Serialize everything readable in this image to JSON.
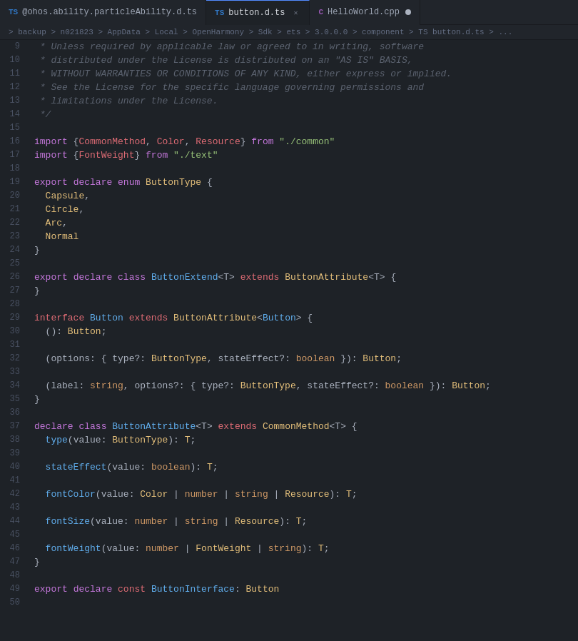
{
  "tabs": [
    {
      "id": "tab1",
      "icon": "ts",
      "label": "@ohos.ability.particleAbility.d.ts",
      "active": false,
      "modified": false
    },
    {
      "id": "tab2",
      "icon": "ts",
      "label": "button.d.ts",
      "active": true,
      "modified": false
    },
    {
      "id": "tab3",
      "icon": "cpp",
      "label": "HelloWorld.cpp",
      "active": false,
      "modified": true
    }
  ],
  "breadcrumb": "> backup > n021823 > AppData > Local > OpenHarmony > Sdk > ets > 3.0.0.0 > component > TS button.d.ts > ...",
  "lines": [
    {
      "num": 9,
      "tokens": [
        {
          "t": " * Unless required by applicable law or agreed to in writing, software",
          "c": "comment"
        }
      ]
    },
    {
      "num": 10,
      "tokens": [
        {
          "t": " * distributed under the License is distributed on an \"AS IS\" BASIS,",
          "c": "comment"
        }
      ]
    },
    {
      "num": 11,
      "tokens": [
        {
          "t": " * WITHOUT WARRANTIES OR CONDITIONS OF ANY KIND, either express or implied.",
          "c": "comment"
        }
      ]
    },
    {
      "num": 12,
      "tokens": [
        {
          "t": " * See the License for the specific language governing permissions and",
          "c": "comment"
        }
      ]
    },
    {
      "num": 13,
      "tokens": [
        {
          "t": " * limitations under the License.",
          "c": "comment"
        }
      ]
    },
    {
      "num": 14,
      "tokens": [
        {
          "t": " */",
          "c": "comment"
        }
      ]
    },
    {
      "num": 15,
      "tokens": []
    },
    {
      "num": 16,
      "tokens": [
        {
          "t": "import",
          "c": "kw"
        },
        {
          "t": " {",
          "c": "punct"
        },
        {
          "t": "CommonMethod",
          "c": "import-name"
        },
        {
          "t": ", ",
          "c": "punct"
        },
        {
          "t": "Color",
          "c": "import-name"
        },
        {
          "t": ", ",
          "c": "punct"
        },
        {
          "t": "Resource",
          "c": "import-name"
        },
        {
          "t": "} ",
          "c": "punct"
        },
        {
          "t": "from",
          "c": "from-kw"
        },
        {
          "t": " ",
          "c": ""
        },
        {
          "t": "\"./common\"",
          "c": "str"
        }
      ]
    },
    {
      "num": 17,
      "tokens": [
        {
          "t": "import",
          "c": "kw"
        },
        {
          "t": " {",
          "c": "punct"
        },
        {
          "t": "FontWeight",
          "c": "import-name"
        },
        {
          "t": "} ",
          "c": "punct"
        },
        {
          "t": "from",
          "c": "from-kw"
        },
        {
          "t": " ",
          "c": ""
        },
        {
          "t": "\"./text\"",
          "c": "str"
        }
      ]
    },
    {
      "num": 18,
      "tokens": []
    },
    {
      "num": 19,
      "tokens": [
        {
          "t": "export",
          "c": "kw"
        },
        {
          "t": " ",
          "c": ""
        },
        {
          "t": "declare",
          "c": "kw"
        },
        {
          "t": " ",
          "c": ""
        },
        {
          "t": "enum",
          "c": "kw"
        },
        {
          "t": " ",
          "c": ""
        },
        {
          "t": "ButtonType",
          "c": "type"
        },
        {
          "t": " {",
          "c": "punct"
        }
      ]
    },
    {
      "num": 20,
      "tokens": [
        {
          "t": "  ",
          "c": ""
        },
        {
          "t": "Capsule",
          "c": "prop"
        },
        {
          "t": ",",
          "c": "punct"
        }
      ]
    },
    {
      "num": 21,
      "tokens": [
        {
          "t": "  ",
          "c": ""
        },
        {
          "t": "Circle",
          "c": "prop"
        },
        {
          "t": ",",
          "c": "punct"
        }
      ]
    },
    {
      "num": 22,
      "tokens": [
        {
          "t": "  ",
          "c": ""
        },
        {
          "t": "Arc",
          "c": "prop"
        },
        {
          "t": ",",
          "c": "punct"
        }
      ]
    },
    {
      "num": 23,
      "tokens": [
        {
          "t": "  ",
          "c": ""
        },
        {
          "t": "Normal",
          "c": "prop"
        }
      ]
    },
    {
      "num": 24,
      "tokens": [
        {
          "t": "}",
          "c": "punct"
        }
      ]
    },
    {
      "num": 25,
      "tokens": []
    },
    {
      "num": 26,
      "tokens": [
        {
          "t": "export",
          "c": "kw"
        },
        {
          "t": " ",
          "c": ""
        },
        {
          "t": "declare",
          "c": "kw"
        },
        {
          "t": " ",
          "c": ""
        },
        {
          "t": "class",
          "c": "kw"
        },
        {
          "t": " ",
          "c": ""
        },
        {
          "t": "ButtonExtend",
          "c": "cls"
        },
        {
          "t": "<T> ",
          "c": "punct"
        },
        {
          "t": "extends",
          "c": "kw2"
        },
        {
          "t": " ",
          "c": ""
        },
        {
          "t": "ButtonAttribute",
          "c": "type"
        },
        {
          "t": "<T> {",
          "c": "punct"
        }
      ]
    },
    {
      "num": 27,
      "tokens": [
        {
          "t": "}",
          "c": "punct"
        }
      ]
    },
    {
      "num": 28,
      "tokens": []
    },
    {
      "num": 29,
      "tokens": [
        {
          "t": "interface",
          "c": "kw2"
        },
        {
          "t": " ",
          "c": ""
        },
        {
          "t": "Button",
          "c": "cls"
        },
        {
          "t": " ",
          "c": ""
        },
        {
          "t": "extends",
          "c": "kw2"
        },
        {
          "t": " ",
          "c": ""
        },
        {
          "t": "ButtonAttribute",
          "c": "type"
        },
        {
          "t": "<",
          "c": "punct"
        },
        {
          "t": "Button",
          "c": "cls"
        },
        {
          "t": "> {",
          "c": "punct"
        }
      ]
    },
    {
      "num": 30,
      "tokens": [
        {
          "t": "  ",
          "c": ""
        },
        {
          "t": "()",
          "c": "punct"
        },
        {
          "t": ": ",
          "c": "punct"
        },
        {
          "t": "Button",
          "c": "type"
        },
        {
          "t": ";",
          "c": "punct"
        }
      ]
    },
    {
      "num": 31,
      "tokens": []
    },
    {
      "num": 32,
      "tokens": [
        {
          "t": "  ",
          "c": ""
        },
        {
          "t": "(options",
          "c": "punct"
        },
        {
          "t": ": { ",
          "c": "punct"
        },
        {
          "t": "type",
          "c": "param"
        },
        {
          "t": "?: ",
          "c": "punct"
        },
        {
          "t": "ButtonType",
          "c": "type"
        },
        {
          "t": ", ",
          "c": "punct"
        },
        {
          "t": "stateEffect",
          "c": "param"
        },
        {
          "t": "?: ",
          "c": "punct"
        },
        {
          "t": "boolean",
          "c": "bool-kw"
        },
        {
          "t": " }): ",
          "c": "punct"
        },
        {
          "t": "Button",
          "c": "type"
        },
        {
          "t": ";",
          "c": "punct"
        }
      ]
    },
    {
      "num": 33,
      "tokens": []
    },
    {
      "num": 34,
      "tokens": [
        {
          "t": "  ",
          "c": ""
        },
        {
          "t": "(label",
          "c": "punct"
        },
        {
          "t": ": ",
          "c": "punct"
        },
        {
          "t": "string",
          "c": "bool-kw"
        },
        {
          "t": ", ",
          "c": "punct"
        },
        {
          "t": "options",
          "c": "param"
        },
        {
          "t": "?: { ",
          "c": "punct"
        },
        {
          "t": "type",
          "c": "param"
        },
        {
          "t": "?: ",
          "c": "punct"
        },
        {
          "t": "ButtonType",
          "c": "type"
        },
        {
          "t": ", ",
          "c": "punct"
        },
        {
          "t": "stateEffect",
          "c": "param"
        },
        {
          "t": "?: ",
          "c": "punct"
        },
        {
          "t": "boolean",
          "c": "bool-kw"
        },
        {
          "t": " }): ",
          "c": "punct"
        },
        {
          "t": "Button",
          "c": "type"
        },
        {
          "t": ";",
          "c": "punct"
        }
      ]
    },
    {
      "num": 35,
      "tokens": [
        {
          "t": "}",
          "c": "punct"
        }
      ]
    },
    {
      "num": 36,
      "tokens": []
    },
    {
      "num": 37,
      "tokens": [
        {
          "t": "declare",
          "c": "kw"
        },
        {
          "t": " ",
          "c": ""
        },
        {
          "t": "class",
          "c": "kw"
        },
        {
          "t": " ",
          "c": ""
        },
        {
          "t": "ButtonAttribute",
          "c": "cls"
        },
        {
          "t": "<T> ",
          "c": "punct"
        },
        {
          "t": "extends",
          "c": "kw2"
        },
        {
          "t": " ",
          "c": ""
        },
        {
          "t": "CommonMethod",
          "c": "type"
        },
        {
          "t": "<T> {",
          "c": "punct"
        }
      ]
    },
    {
      "num": 38,
      "tokens": [
        {
          "t": "  ",
          "c": ""
        },
        {
          "t": "type",
          "c": "fn"
        },
        {
          "t": "(",
          "c": "punct"
        },
        {
          "t": "value",
          "c": "param"
        },
        {
          "t": ": ",
          "c": "punct"
        },
        {
          "t": "ButtonType",
          "c": "type"
        },
        {
          "t": "): ",
          "c": "punct"
        },
        {
          "t": "T",
          "c": "type"
        },
        {
          "t": ";",
          "c": "punct"
        }
      ]
    },
    {
      "num": 39,
      "tokens": []
    },
    {
      "num": 40,
      "tokens": [
        {
          "t": "  ",
          "c": ""
        },
        {
          "t": "stateEffect",
          "c": "fn"
        },
        {
          "t": "(",
          "c": "punct"
        },
        {
          "t": "value",
          "c": "param"
        },
        {
          "t": ": ",
          "c": "punct"
        },
        {
          "t": "boolean",
          "c": "bool-kw"
        },
        {
          "t": "): ",
          "c": "punct"
        },
        {
          "t": "T",
          "c": "type"
        },
        {
          "t": ";",
          "c": "punct"
        }
      ]
    },
    {
      "num": 41,
      "tokens": []
    },
    {
      "num": 42,
      "tokens": [
        {
          "t": "  ",
          "c": ""
        },
        {
          "t": "fontColor",
          "c": "fn"
        },
        {
          "t": "(",
          "c": "punct"
        },
        {
          "t": "value",
          "c": "param"
        },
        {
          "t": ": ",
          "c": "punct"
        },
        {
          "t": "Color",
          "c": "type"
        },
        {
          "t": " | ",
          "c": "punct"
        },
        {
          "t": "number",
          "c": "bool-kw"
        },
        {
          "t": " | ",
          "c": "punct"
        },
        {
          "t": "string",
          "c": "bool-kw"
        },
        {
          "t": " | ",
          "c": "punct"
        },
        {
          "t": "Resource",
          "c": "type"
        },
        {
          "t": "): ",
          "c": "punct"
        },
        {
          "t": "T",
          "c": "type"
        },
        {
          "t": ";",
          "c": "punct"
        }
      ]
    },
    {
      "num": 43,
      "tokens": []
    },
    {
      "num": 44,
      "tokens": [
        {
          "t": "  ",
          "c": ""
        },
        {
          "t": "fontSize",
          "c": "fn"
        },
        {
          "t": "(",
          "c": "punct"
        },
        {
          "t": "value",
          "c": "param"
        },
        {
          "t": ": ",
          "c": "punct"
        },
        {
          "t": "number",
          "c": "bool-kw"
        },
        {
          "t": " | ",
          "c": "punct"
        },
        {
          "t": "string",
          "c": "bool-kw"
        },
        {
          "t": " | ",
          "c": "punct"
        },
        {
          "t": "Resource",
          "c": "type"
        },
        {
          "t": "): ",
          "c": "punct"
        },
        {
          "t": "T",
          "c": "type"
        },
        {
          "t": ";",
          "c": "punct"
        }
      ]
    },
    {
      "num": 45,
      "tokens": []
    },
    {
      "num": 46,
      "tokens": [
        {
          "t": "  ",
          "c": ""
        },
        {
          "t": "fontWeight",
          "c": "fn"
        },
        {
          "t": "(",
          "c": "punct"
        },
        {
          "t": "value",
          "c": "param"
        },
        {
          "t": ": ",
          "c": "punct"
        },
        {
          "t": "number",
          "c": "bool-kw"
        },
        {
          "t": " | ",
          "c": "punct"
        },
        {
          "t": "FontWeight",
          "c": "type"
        },
        {
          "t": " | ",
          "c": "punct"
        },
        {
          "t": "string",
          "c": "bool-kw"
        },
        {
          "t": "): ",
          "c": "punct"
        },
        {
          "t": "T",
          "c": "type"
        },
        {
          "t": ";",
          "c": "punct"
        }
      ]
    },
    {
      "num": 47,
      "tokens": [
        {
          "t": "}",
          "c": "punct"
        }
      ]
    },
    {
      "num": 48,
      "tokens": []
    },
    {
      "num": 49,
      "tokens": [
        {
          "t": "export",
          "c": "kw"
        },
        {
          "t": " ",
          "c": ""
        },
        {
          "t": "declare",
          "c": "kw"
        },
        {
          "t": " ",
          "c": ""
        },
        {
          "t": "const",
          "c": "kw2"
        },
        {
          "t": " ",
          "c": ""
        },
        {
          "t": "ButtonInterface",
          "c": "cls"
        },
        {
          "t": ": ",
          "c": "punct"
        },
        {
          "t": "Button",
          "c": "type"
        }
      ]
    },
    {
      "num": 50,
      "tokens": []
    }
  ]
}
